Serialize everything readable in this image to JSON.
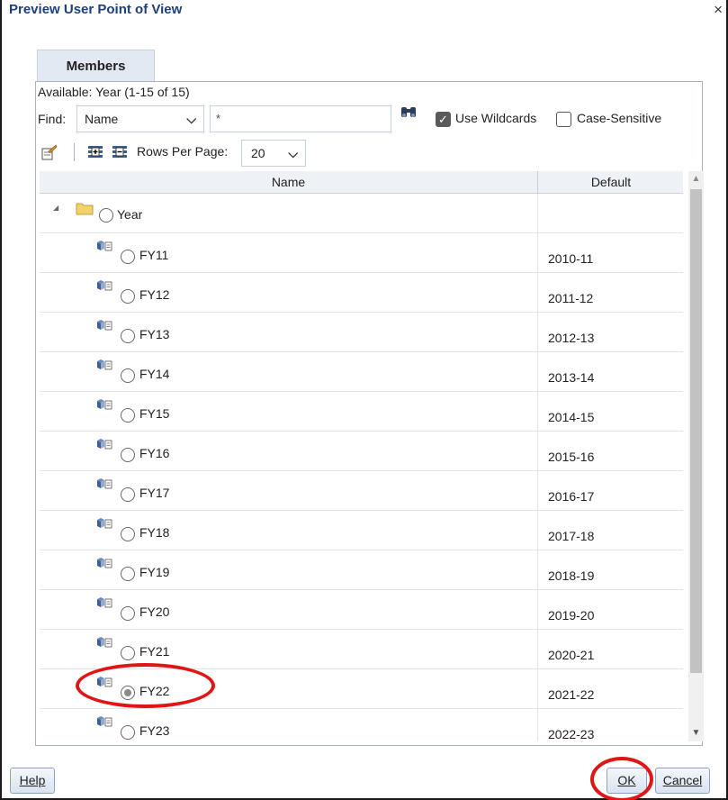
{
  "dialog": {
    "title": "Preview User Point of View",
    "close_label": "×"
  },
  "tab": {
    "label": "Members"
  },
  "available": {
    "text": "Available:  Year (1-15 of 15)"
  },
  "find": {
    "label": "Find:",
    "field_value": "Name",
    "search_value": "*"
  },
  "options": {
    "use_wildcards_label": "Use Wildcards",
    "use_wildcards_checked": true,
    "case_sensitive_label": "Case-Sensitive",
    "case_sensitive_checked": false
  },
  "toolbar": {
    "rows_per_page_label": "Rows Per Page:",
    "rows_per_page_value": "20"
  },
  "grid": {
    "columns": [
      "Name",
      "Default"
    ],
    "rows": [
      {
        "name": "Year",
        "default": "",
        "type": "root",
        "selected": false
      },
      {
        "name": "FY11",
        "default": "2010-11",
        "type": "member",
        "selected": false
      },
      {
        "name": "FY12",
        "default": "2011-12",
        "type": "member",
        "selected": false
      },
      {
        "name": "FY13",
        "default": "2012-13",
        "type": "member",
        "selected": false
      },
      {
        "name": "FY14",
        "default": "2013-14",
        "type": "member",
        "selected": false
      },
      {
        "name": "FY15",
        "default": "2014-15",
        "type": "member",
        "selected": false
      },
      {
        "name": "FY16",
        "default": "2015-16",
        "type": "member",
        "selected": false
      },
      {
        "name": "FY17",
        "default": "2016-17",
        "type": "member",
        "selected": false
      },
      {
        "name": "FY18",
        "default": "2017-18",
        "type": "member",
        "selected": false
      },
      {
        "name": "FY19",
        "default": "2018-19",
        "type": "member",
        "selected": false
      },
      {
        "name": "FY20",
        "default": "2019-20",
        "type": "member",
        "selected": false
      },
      {
        "name": "FY21",
        "default": "2020-21",
        "type": "member",
        "selected": false
      },
      {
        "name": "FY22",
        "default": "2021-22",
        "type": "member",
        "selected": true
      },
      {
        "name": "FY23",
        "default": "2022-23",
        "type": "member",
        "selected": false
      }
    ]
  },
  "buttons": {
    "help": "Help",
    "ok": "OK",
    "cancel": "Cancel"
  },
  "colors": {
    "title": "#1f3f7a",
    "annotation": "#e01515",
    "tab_bg": "#e3e9f2"
  }
}
